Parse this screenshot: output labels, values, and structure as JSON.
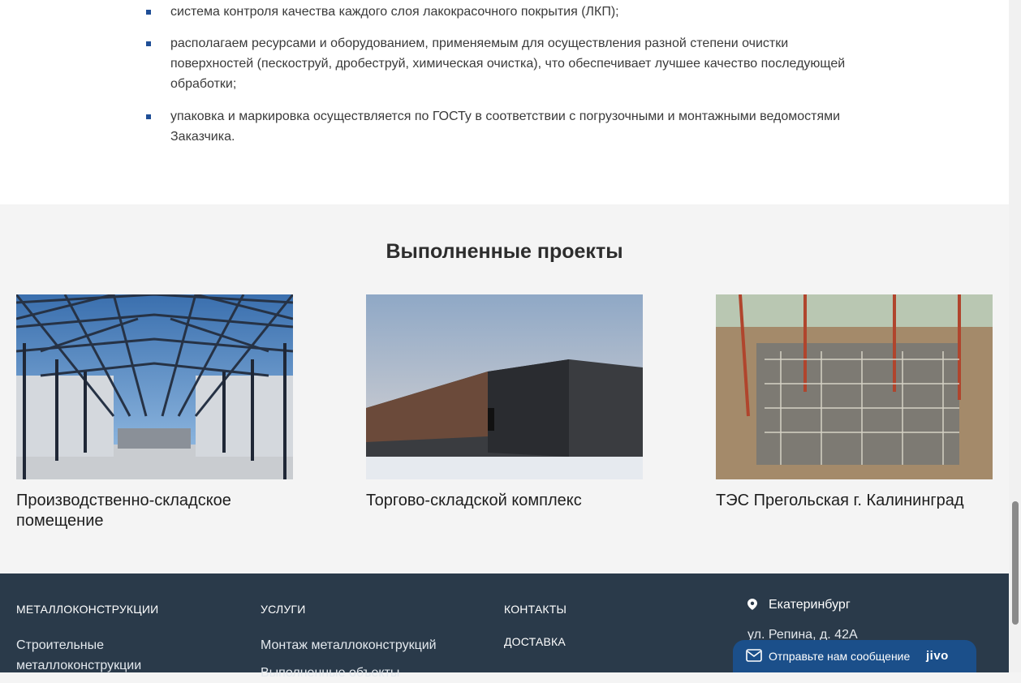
{
  "bullets": [
    "система контроля качества каждого слоя лакокрасочного покрытия (ЛКП);",
    "располагаем ресурсами и оборудованием, применяемым для осуществления разной степени очистки поверхностей (пескоструй, дробеструй, химическая очистка), что обеспечивает лучшее качество последующей обработки;",
    "упаковка и маркировка осуществляется по ГОСТу в соответствии с погрузочными и монтажными ведомостями Заказчика."
  ],
  "projects": {
    "title": "Выполненные проекты",
    "items": [
      {
        "caption": "Производственно-складское помещение"
      },
      {
        "caption": "Торгово-складской комплекс"
      },
      {
        "caption": "ТЭС Прегольская г. Калининград"
      }
    ]
  },
  "footer": {
    "col1": {
      "heading": "МЕТАЛЛОКОНСТРУКЦИИ",
      "links": [
        "Строительные металлоконструкции"
      ]
    },
    "col2": {
      "heading": "УСЛУГИ",
      "links": [
        "Монтаж металлоконструкций",
        "Выполненные объекты"
      ]
    },
    "col3": {
      "links": [
        "КОНТАКТЫ",
        "ДОСТАВКА"
      ]
    },
    "col4": {
      "city": "Екатеринбург",
      "address": "ул. Репина, д. 42А"
    }
  },
  "chat": {
    "label": "Отправьте нам сообщение",
    "brand": "jivo"
  },
  "colors": {
    "footer_bg": "#2a3a4a",
    "accent": "#1f4e96",
    "chat_bg": "#1b4f8a"
  }
}
